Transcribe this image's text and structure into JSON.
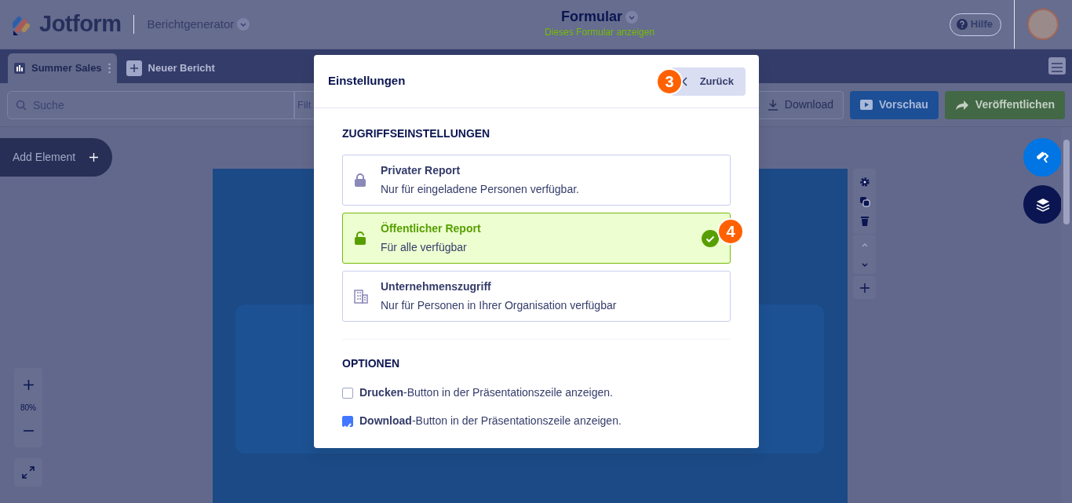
{
  "header": {
    "logo": "Jotform",
    "app_menu": "Berichtgenerator",
    "form_title": "Formular",
    "form_link": "Dieses Formular anzeigen",
    "help": "Hilfe"
  },
  "tabs": [
    {
      "kind": "report",
      "label": "Summer Sales",
      "selected": true
    },
    {
      "kind": "new",
      "label": "Neuer Bericht",
      "selected": false
    }
  ],
  "toolbar": {
    "search_placeholder": "Suche",
    "filter_placeholder": "Filt",
    "buttons": [
      {
        "kind": "download",
        "label": "Download"
      },
      {
        "kind": "preview",
        "label": "Vorschau"
      },
      {
        "kind": "publish",
        "label": "Veröffentlichen"
      }
    ]
  },
  "canvas": {
    "add_element": "Add Element",
    "zoom": "80%"
  },
  "dialog": {
    "title": "Einstellungen",
    "back": "Zurück",
    "access_heading": "ZUGRIFFSEINSTELLUNGEN",
    "access_options": [
      {
        "kind": "private",
        "title": "Privater Report",
        "description": "Nur für eingeladene Personen verfügbar.",
        "selected": false
      },
      {
        "kind": "public",
        "title": "Öffentlicher Report",
        "description": "Für alle verfügbar",
        "selected": true
      },
      {
        "kind": "company",
        "title": "Unternehmenszugriff",
        "description": "Nur für Personen in Ihrer Organisation verfügbar",
        "selected": false
      }
    ],
    "options_heading": "OPTIONEN",
    "options": [
      {
        "label": "**Drucken**-Button in der Präsentationszeile anzeigen.",
        "checked": false
      },
      {
        "label": "**Download**-Button in der Präsentationszeile anzeigen.",
        "checked": true
      }
    ]
  },
  "step_markers": [
    "3",
    "4"
  ]
}
